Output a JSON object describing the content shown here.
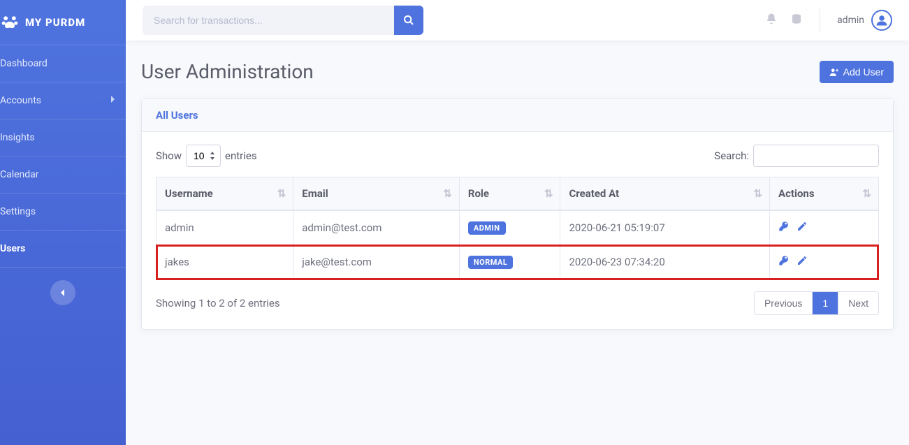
{
  "brand": "MY PURDM",
  "sidebar": {
    "items": [
      {
        "label": "Dashboard",
        "chevron": false,
        "active": false
      },
      {
        "label": "Accounts",
        "chevron": true,
        "active": false
      },
      {
        "label": "Insights",
        "chevron": false,
        "active": false
      },
      {
        "label": "Calendar",
        "chevron": false,
        "active": false
      },
      {
        "label": "Settings",
        "chevron": false,
        "active": false
      },
      {
        "label": "Users",
        "chevron": false,
        "active": true
      }
    ]
  },
  "topbar": {
    "search_placeholder": "Search for transactions...",
    "username": "admin"
  },
  "page": {
    "title": "User Administration",
    "add_user_label": "Add User"
  },
  "card": {
    "title": "All Users"
  },
  "datatable": {
    "show_label": "Show",
    "entries_label": "entries",
    "length_value": "10",
    "search_label": "Search:",
    "columns": [
      "Username",
      "Email",
      "Role",
      "Created At",
      "Actions"
    ],
    "rows": [
      {
        "username": "admin",
        "email": "admin@test.com",
        "role": "ADMIN",
        "created_at": "2020-06-21 05:19:07",
        "highlight": false
      },
      {
        "username": "jakes",
        "email": "jake@test.com",
        "role": "NORMAL",
        "created_at": "2020-06-23 07:34:20",
        "highlight": true
      }
    ],
    "info": "Showing 1 to 2 of 2 entries",
    "pagination": {
      "previous": "Previous",
      "next": "Next",
      "current": "1"
    }
  }
}
